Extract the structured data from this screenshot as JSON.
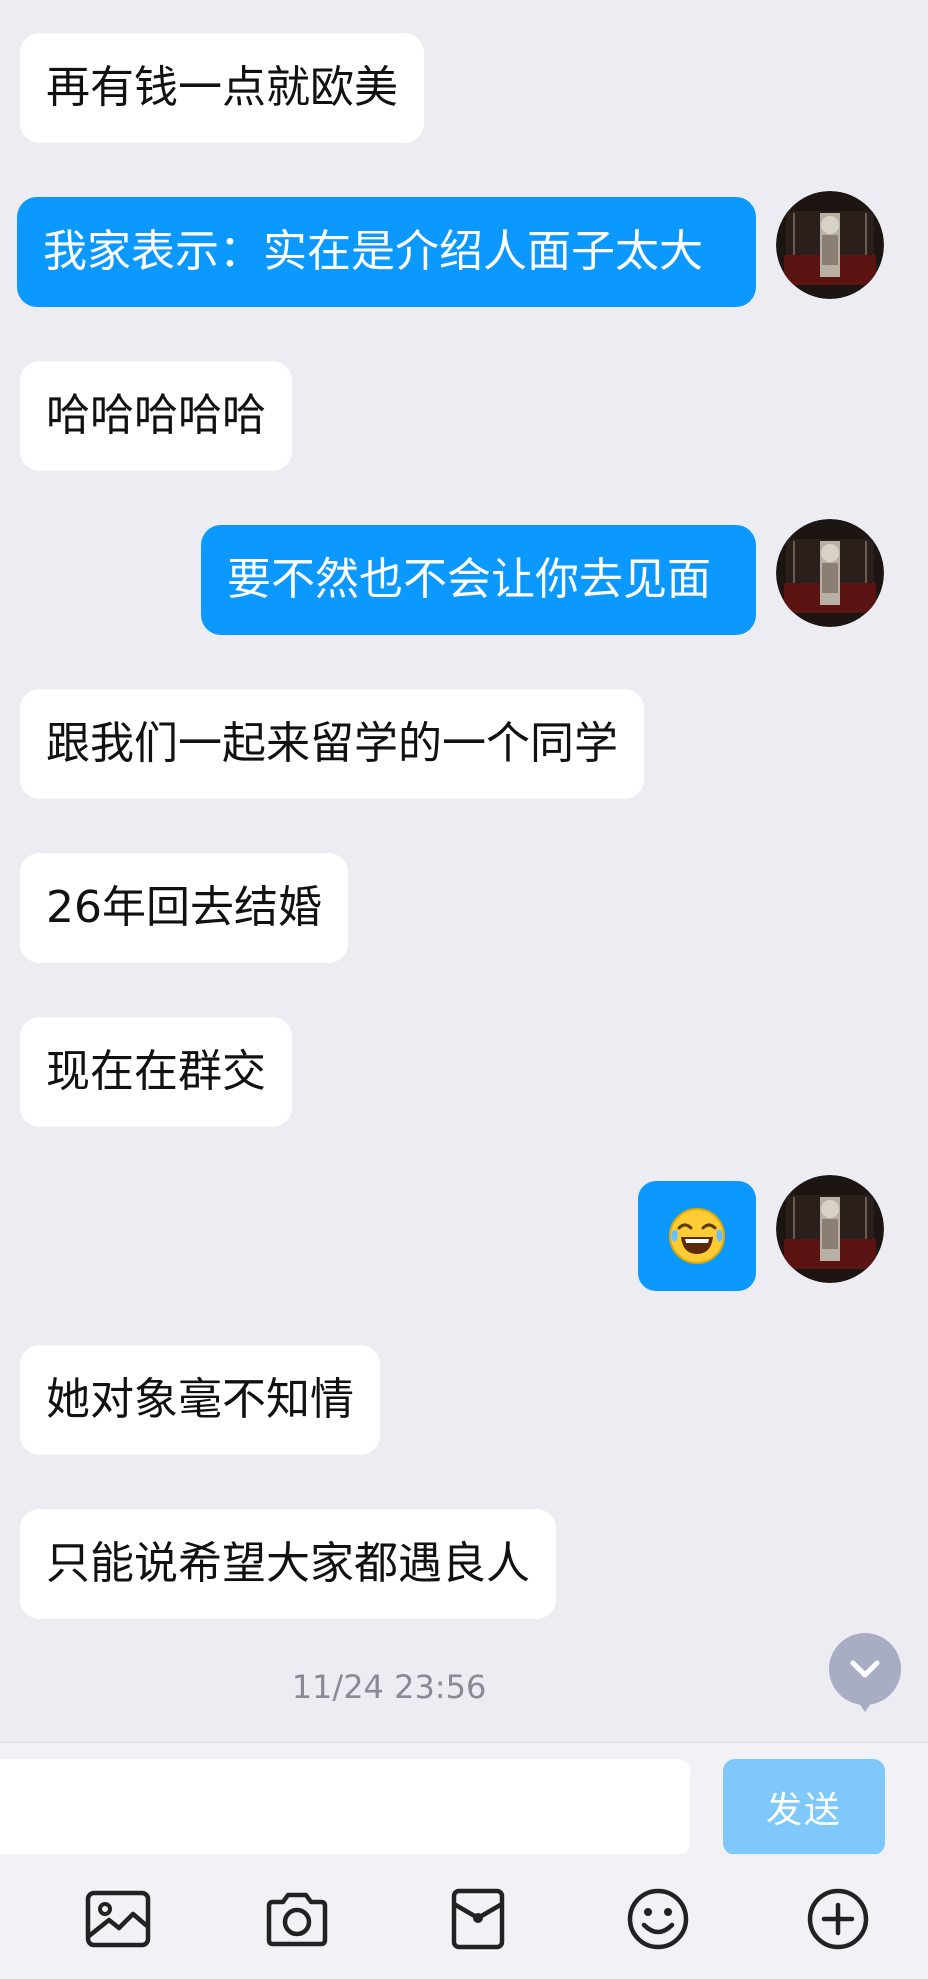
{
  "messages": [
    {
      "side": "in",
      "text": "再有钱一点就欧美"
    },
    {
      "side": "out",
      "text": "我家表示：实在是介绍人面子太大"
    },
    {
      "side": "in",
      "text": "哈哈哈哈哈"
    },
    {
      "side": "out",
      "text": "要不然也不会让你去见面"
    },
    {
      "side": "in",
      "text": "跟我们一起来留学的一个同学"
    },
    {
      "side": "in",
      "text": "26年回去结婚"
    },
    {
      "side": "in",
      "text": "现在在群交"
    },
    {
      "side": "out",
      "emoji": "😂"
    },
    {
      "side": "in",
      "text": "她对象毫不知情"
    },
    {
      "side": "in",
      "text": "只能说希望大家都遇良人"
    }
  ],
  "timestamp": "11/24 23:56",
  "composer": {
    "placeholder": "",
    "send_label": "发送"
  },
  "toolbar": [
    "image-icon",
    "camera-icon",
    "red-packet-icon",
    "emoji-icon",
    "plus-icon"
  ],
  "colors": {
    "background": "#ececf2",
    "outgoing_bubble": "#0b99ff",
    "incoming_bubble": "#ffffff",
    "send_button_disabled": "#7fc8fb"
  }
}
